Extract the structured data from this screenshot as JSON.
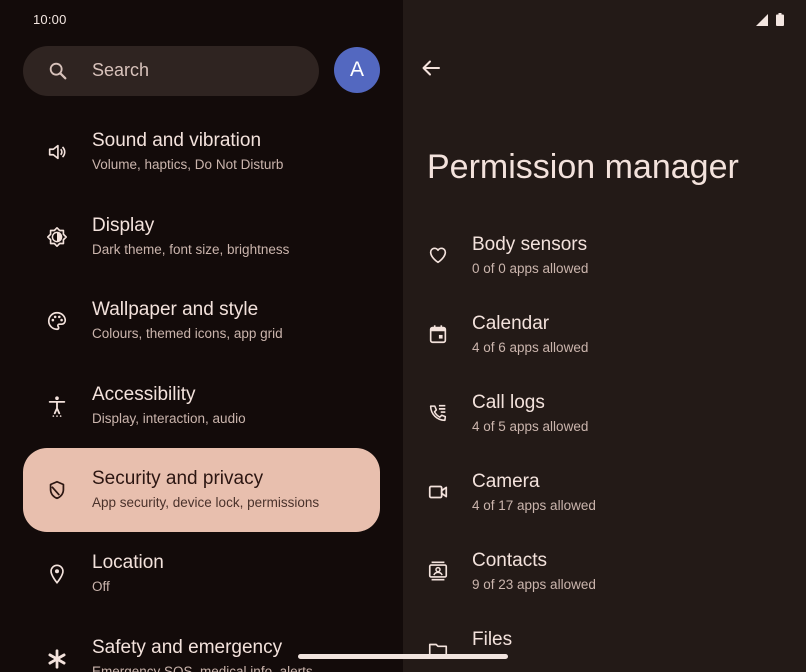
{
  "status_bar": {
    "time": "10:00",
    "icons": [
      "signal-icon",
      "battery-icon"
    ]
  },
  "search": {
    "placeholder": "Search",
    "avatar_letter": "A"
  },
  "settings_menu": {
    "items": [
      {
        "title": "Sound and vibration",
        "subtitle": "Volume, haptics, Do Not Disturb",
        "icon": "volume-icon"
      },
      {
        "title": "Display",
        "subtitle": "Dark theme, font size, brightness",
        "icon": "brightness-icon"
      },
      {
        "title": "Wallpaper and style",
        "subtitle": "Colours, themed icons, app grid",
        "icon": "palette-icon"
      },
      {
        "title": "Accessibility",
        "subtitle": "Display, interaction, audio",
        "icon": "accessibility-icon"
      },
      {
        "title": "Security and privacy",
        "subtitle": "App security, device lock, permissions",
        "icon": "shield-icon",
        "selected": true
      },
      {
        "title": "Location",
        "subtitle": "Off",
        "icon": "location-pin-icon"
      },
      {
        "title": "Safety and emergency",
        "subtitle": "Emergency SOS, medical info, alerts",
        "icon": "asterisk-icon"
      }
    ]
  },
  "permission_manager": {
    "title": "Permission manager",
    "items": [
      {
        "title": "Body sensors",
        "subtitle": "0 of 0 apps allowed",
        "icon": "heart-icon"
      },
      {
        "title": "Calendar",
        "subtitle": "4 of 6 apps allowed",
        "icon": "calendar-icon"
      },
      {
        "title": "Call logs",
        "subtitle": "4 of 5 apps allowed",
        "icon": "call-log-icon"
      },
      {
        "title": "Camera",
        "subtitle": "4 of 17 apps allowed",
        "icon": "camera-icon"
      },
      {
        "title": "Contacts",
        "subtitle": "9 of 23 apps allowed",
        "icon": "contacts-icon"
      },
      {
        "title": "Files",
        "subtitle": "",
        "icon": "folder-icon"
      }
    ]
  },
  "colors": {
    "left_background": "#130b0a",
    "right_background": "#231a17",
    "selected_item": "#e8bfae",
    "avatar": "#5368c0"
  }
}
